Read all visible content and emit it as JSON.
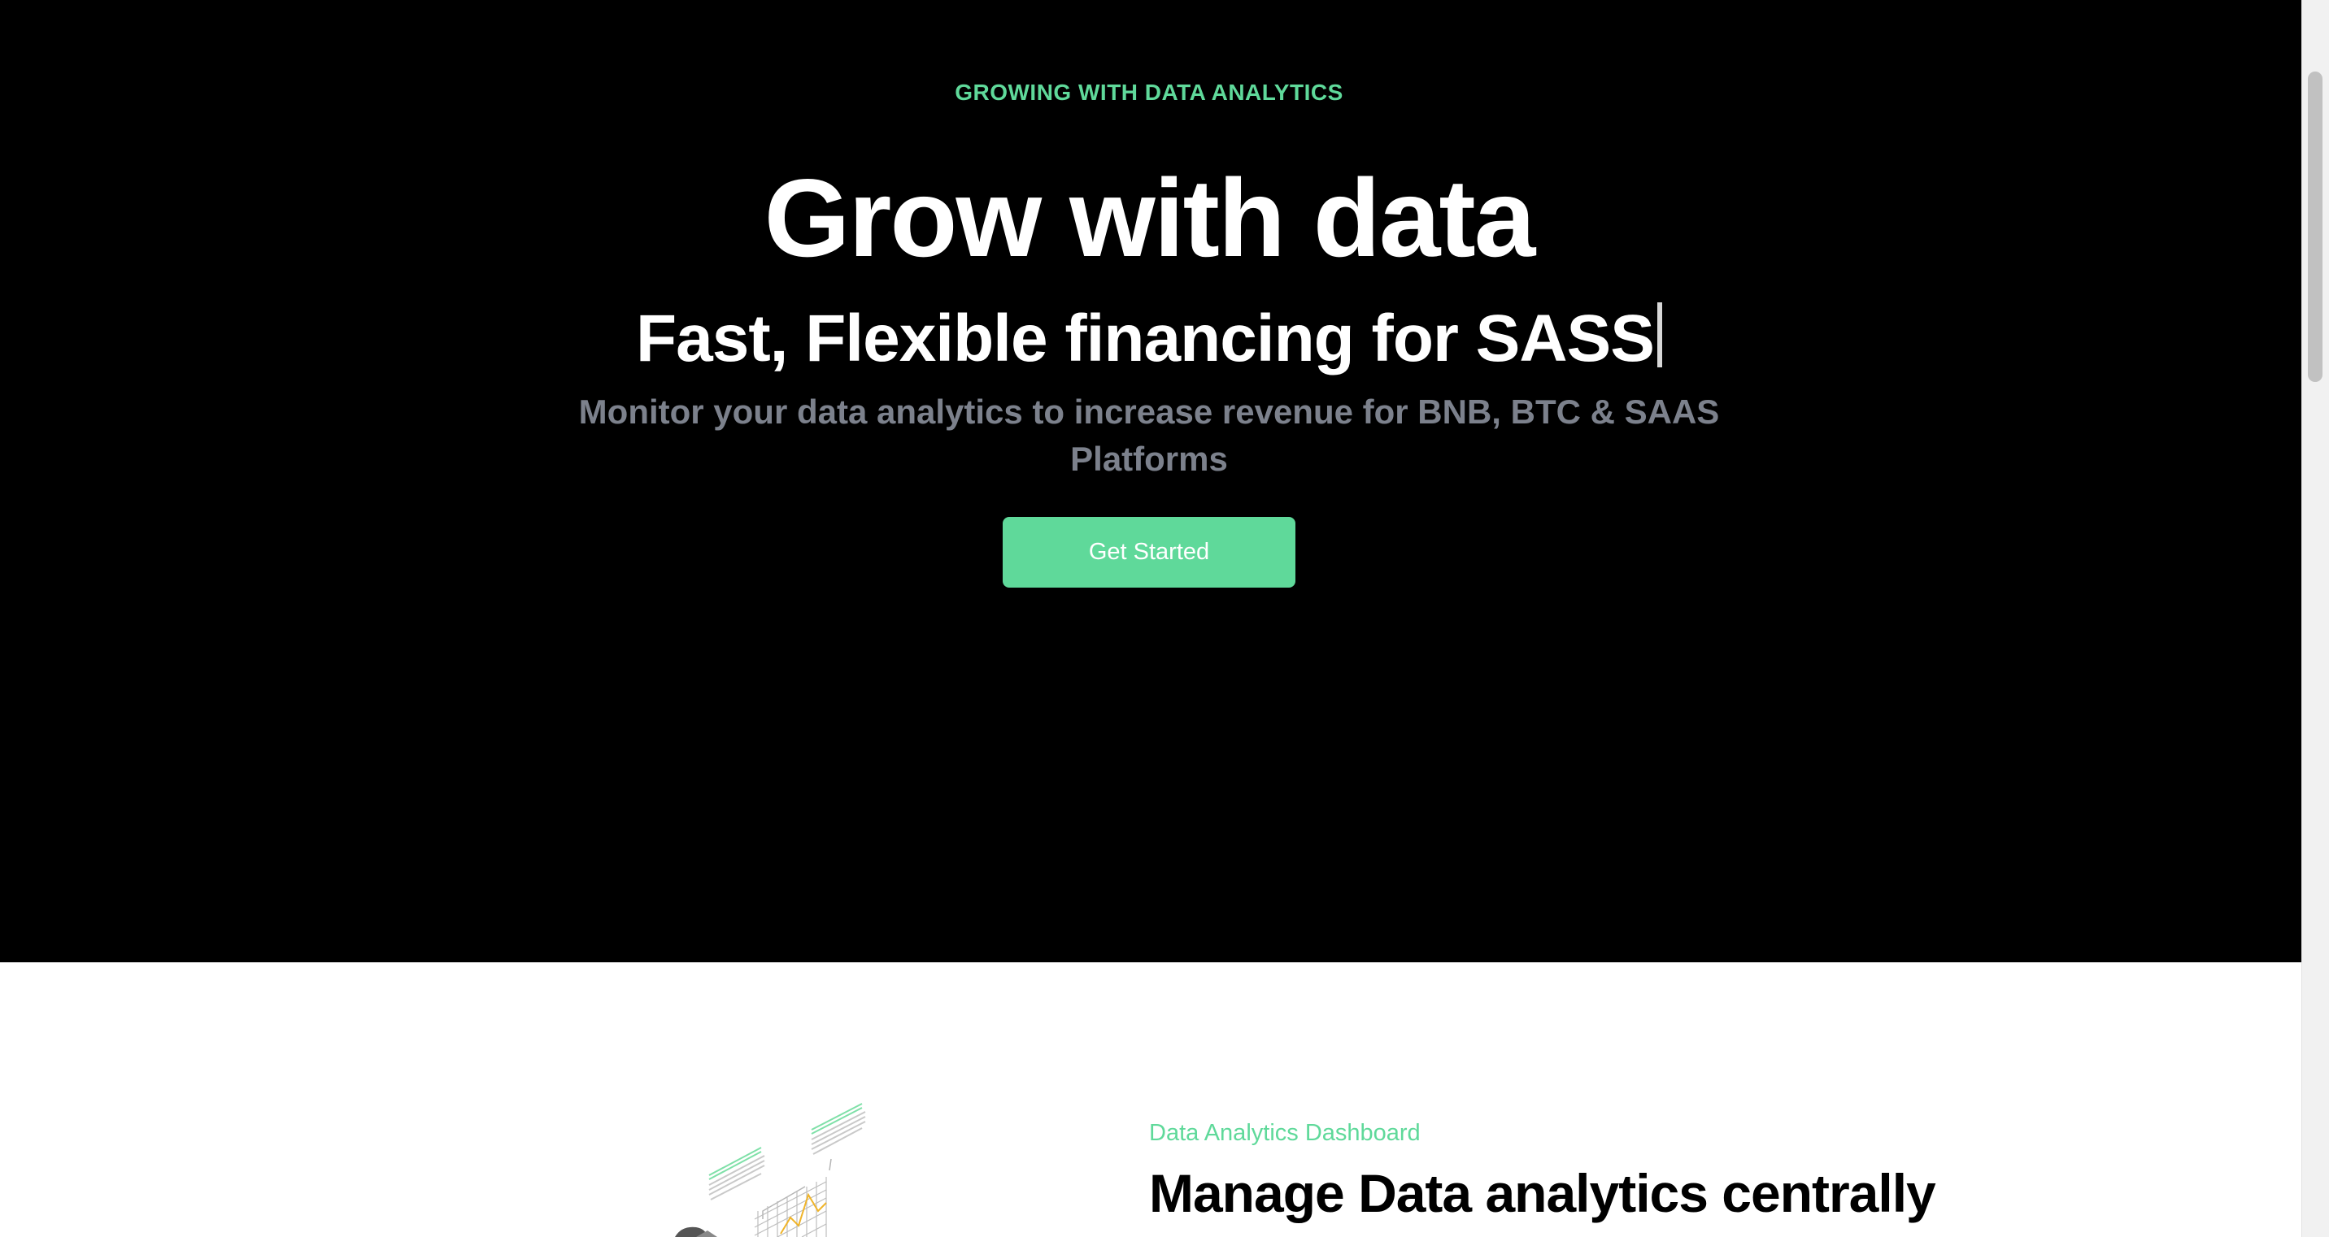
{
  "hero": {
    "eyebrow": "GROWING WITH DATA ANALYTICS",
    "title": "Grow with data",
    "typed_text": "Fast, Flexible financing for SASS",
    "subtitle": "Monitor your data analytics to increase revenue for BNB, BTC & SAAS Platforms",
    "cta_label": "Get Started"
  },
  "feature": {
    "kicker": "Data Analytics Dashboard",
    "title": "Manage Data analytics centrally"
  },
  "colors": {
    "accent": "#5fd99a",
    "hero_background": "#000000",
    "subtitle_gray": "#7c818c",
    "chart_yellow": "#f0b429"
  },
  "icons": {
    "illustration": "isometric-analytics-illustration"
  }
}
